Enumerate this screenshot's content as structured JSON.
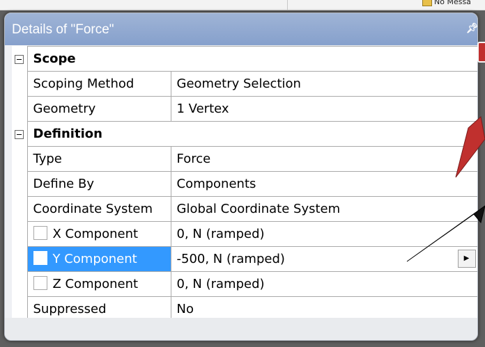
{
  "top_strip": {
    "message_label": "No Messa"
  },
  "panel": {
    "title": "Details of \"Force\"",
    "pin_icon": "pin-icon"
  },
  "sections": [
    {
      "label": "Scope",
      "rows": [
        {
          "label": "Scoping Method",
          "value": "Geometry Selection"
        },
        {
          "label": "Geometry",
          "value": "1 Vertex"
        }
      ]
    },
    {
      "label": "Definition",
      "rows": [
        {
          "label": "Type",
          "value": "Force"
        },
        {
          "label": "Define By",
          "value": "Components"
        },
        {
          "label": "Coordinate System",
          "value": "Global Coordinate System"
        },
        {
          "label": "X Component",
          "value": "0, N  (ramped)",
          "checkbox": true
        },
        {
          "label": "Y Component",
          "value": "-500, N  (ramped)",
          "checkbox": true,
          "selected": true,
          "dropdown_icon": "triangle-right-icon"
        },
        {
          "label": "Z Component",
          "value": "0, N  (ramped)",
          "checkbox": true
        },
        {
          "label": "Suppressed",
          "value": "No"
        }
      ]
    }
  ],
  "colors": {
    "title_bar": "#8fa8d2",
    "selection": "#3399ff",
    "annotation_red": "#c0302e",
    "annotation_black": "#111111"
  }
}
